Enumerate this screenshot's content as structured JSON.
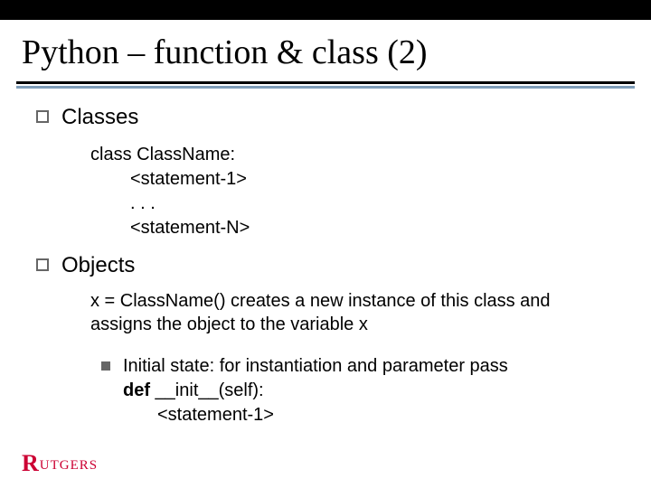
{
  "title": "Python – function & class (2)",
  "section1": {
    "label": "Classes",
    "code": {
      "l1": "class ClassName:",
      "l2": "<statement-1>",
      "l3": ". . .",
      "l4": "<statement-N>"
    }
  },
  "section2": {
    "label": "Objects",
    "body": "x = ClassName() creates a new instance of this class and assigns the object to the variable x",
    "sub": {
      "text": "Initial state: for instantiation and parameter pass",
      "code": {
        "l1_bold": "def",
        "l1_rest": " __init__(self):",
        "l2": "<statement-1>"
      }
    }
  },
  "logo": {
    "r": "R",
    "rest": "UTGERS"
  }
}
